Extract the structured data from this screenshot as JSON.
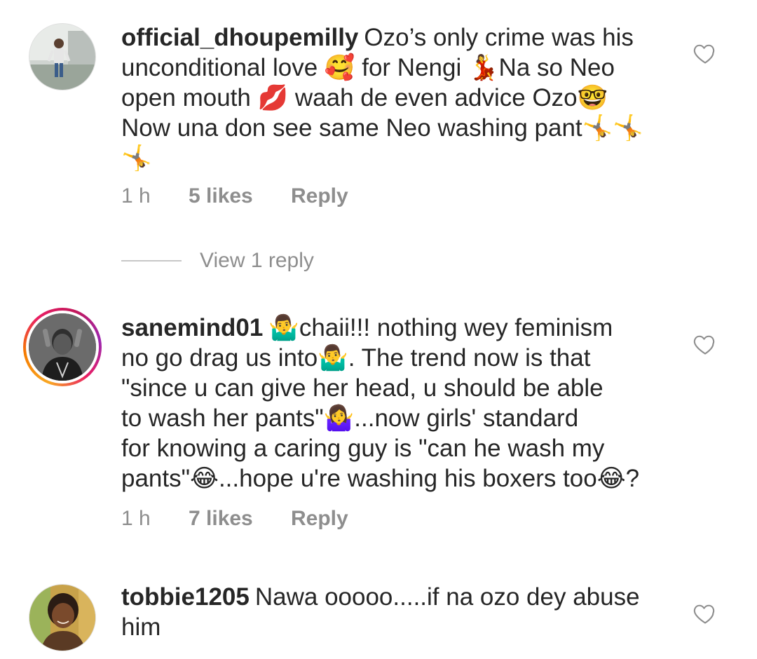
{
  "comments": [
    {
      "username": "official_dhoupemilly",
      "lines": [
        "Ozo’s only crime was his",
        "unconditional love 🥰 for Nengi 💃Na so Neo",
        "open mouth 💋 waah de even advice Ozo🤓",
        "Now una don see same Neo washing pant🤸🤸",
        "🤸"
      ],
      "time": "1 h",
      "likes": "5 likes",
      "reply_label": "Reply"
    },
    {
      "username": "sanemind01",
      "lines": [
        "🤷‍♂️chaii!!! nothing wey feminism",
        "no go drag us into🤷‍♂️. The trend now is that",
        "\"since u can give her head, u should be able",
        "to wash her pants\"🤷‍♀️...now girls' standard",
        "for knowing a caring guy is \"can he wash my",
        "pants\"😂...hope u're washing his boxers too😂?"
      ],
      "time": "1 h",
      "likes": "7 likes",
      "reply_label": "Reply"
    },
    {
      "username": "tobbie1205",
      "lines": [
        "Nawa ooooo.....if na ozo dey abuse",
        "him"
      ]
    }
  ],
  "view_replies": "View 1 reply",
  "icons": {
    "like": "heart-outline-icon"
  },
  "colors": {
    "text": "#262626",
    "secondary": "#8e8e8e",
    "story_ring": "#e91e63"
  }
}
